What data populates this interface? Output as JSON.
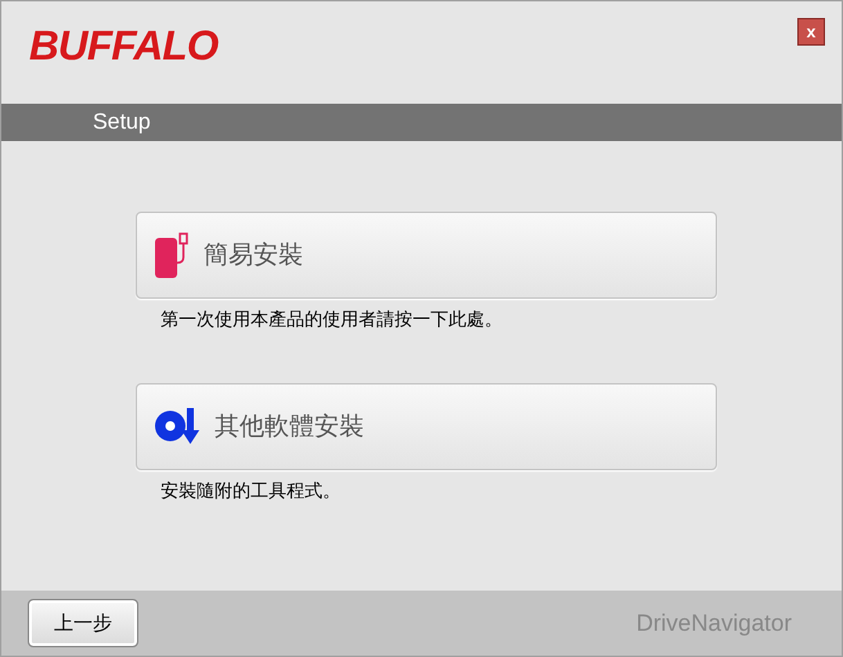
{
  "window": {
    "logo": "BUFFALO",
    "close": "x"
  },
  "header": {
    "title": "Setup"
  },
  "options": [
    {
      "kind": "easy",
      "label": "簡易安裝",
      "description": "第一次使用本產品的使用者請按一下此處。"
    },
    {
      "kind": "software",
      "label": "其他軟體安裝",
      "description": "安裝隨附的工具程式。"
    }
  ],
  "footer": {
    "back": "上一步",
    "brand": "DriveNavigator"
  }
}
